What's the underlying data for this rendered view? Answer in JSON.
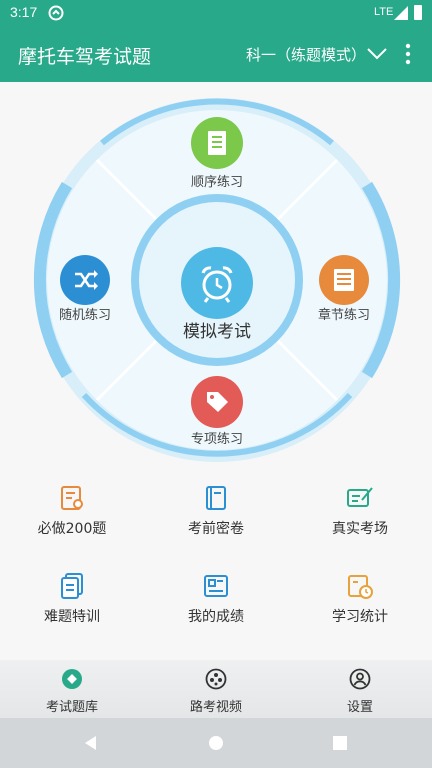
{
  "status": {
    "time": "3:17",
    "network": "LTE"
  },
  "app_bar": {
    "title": "摩托车驾考试题",
    "subject": "科一（练题模式）"
  },
  "wheel": {
    "top": "顺序练习",
    "left": "随机练习",
    "right": "章节练习",
    "bottom": "专项练习",
    "center": "模拟考试"
  },
  "grid": [
    {
      "label": "必做200题",
      "icon": "test-doc-icon"
    },
    {
      "label": "考前密卷",
      "icon": "book-icon"
    },
    {
      "label": "真实考场",
      "icon": "exam-sheet-icon"
    },
    {
      "label": "难题特训",
      "icon": "docs-icon"
    },
    {
      "label": "我的成绩",
      "icon": "newspaper-icon"
    },
    {
      "label": "学习统计",
      "icon": "calendar-clock-icon"
    }
  ],
  "bottom_nav": [
    {
      "label": "考试题库",
      "icon": "question-bank-icon",
      "active": true
    },
    {
      "label": "路考视频",
      "icon": "film-reel-icon",
      "active": false
    },
    {
      "label": "设置",
      "icon": "user-circle-icon",
      "active": false
    }
  ],
  "colors": {
    "primary": "#27a98a",
    "wheel_ring": "#8fd0f2",
    "green": "#7cc84a",
    "blue": "#2d8fd3",
    "orange": "#e78a3c",
    "red": "#e25b56"
  }
}
